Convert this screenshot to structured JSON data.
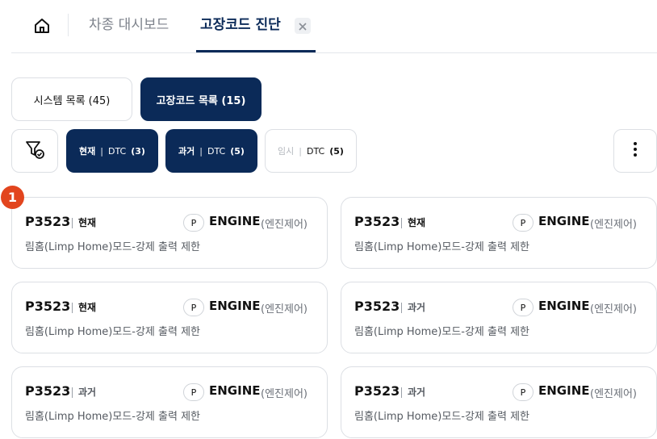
{
  "tabs": {
    "home_icon": "home-icon",
    "items": [
      {
        "label": "차종 대시보드"
      },
      {
        "label": "고장코드 진단"
      }
    ],
    "close_icon": "close-icon"
  },
  "list_toggle": {
    "system_label": "시스템 목록 (45)",
    "dtc_label": "고장코드 목록 (15)"
  },
  "filters": {
    "filter_icon": "filter-check-icon",
    "current": {
      "lead": "현재",
      "sep": "|",
      "type": "DTC",
      "count": "(3)"
    },
    "past": {
      "lead": "과거",
      "sep": "|",
      "type": "DTC",
      "count": "(5)"
    },
    "temp": {
      "lead": "임시",
      "sep": "|",
      "type": "DTC",
      "count": "(5)"
    },
    "more_icon": "more-vertical-icon"
  },
  "badge": {
    "value": "1"
  },
  "cards": [
    {
      "code": "P3523",
      "status": "현재",
      "chip": "P",
      "system": "ENGINE",
      "system_ko": "(엔진제어)",
      "desc": "림홈(Limp Home)모드-강제 출력 제한"
    },
    {
      "code": "P3523",
      "status": "현재",
      "chip": "P",
      "system": "ENGINE",
      "system_ko": "(엔진제어)",
      "desc": "림홈(Limp Home)모드-강제 출력 제한"
    },
    {
      "code": "P3523",
      "status": "현재",
      "chip": "P",
      "system": "ENGINE",
      "system_ko": "(엔진제어)",
      "desc": "림홈(Limp Home)모드-강제 출력 제한"
    },
    {
      "code": "P3523",
      "status": "과거",
      "chip": "P",
      "system": "ENGINE",
      "system_ko": "(엔진제어)",
      "desc": "림홈(Limp Home)모드-강제 출력 제한"
    },
    {
      "code": "P3523",
      "status": "과거",
      "chip": "P",
      "system": "ENGINE",
      "system_ko": "(엔진제어)",
      "desc": "림홈(Limp Home)모드-강제 출력 제한"
    },
    {
      "code": "P3523",
      "status": "과거",
      "chip": "P",
      "system": "ENGINE",
      "system_ko": "(엔진제어)",
      "desc": "림홈(Limp Home)모드-강제 출력 제한"
    }
  ],
  "colors": {
    "navy": "#0b2a58",
    "badge": "#e2451e",
    "border": "#dcdfe4"
  }
}
